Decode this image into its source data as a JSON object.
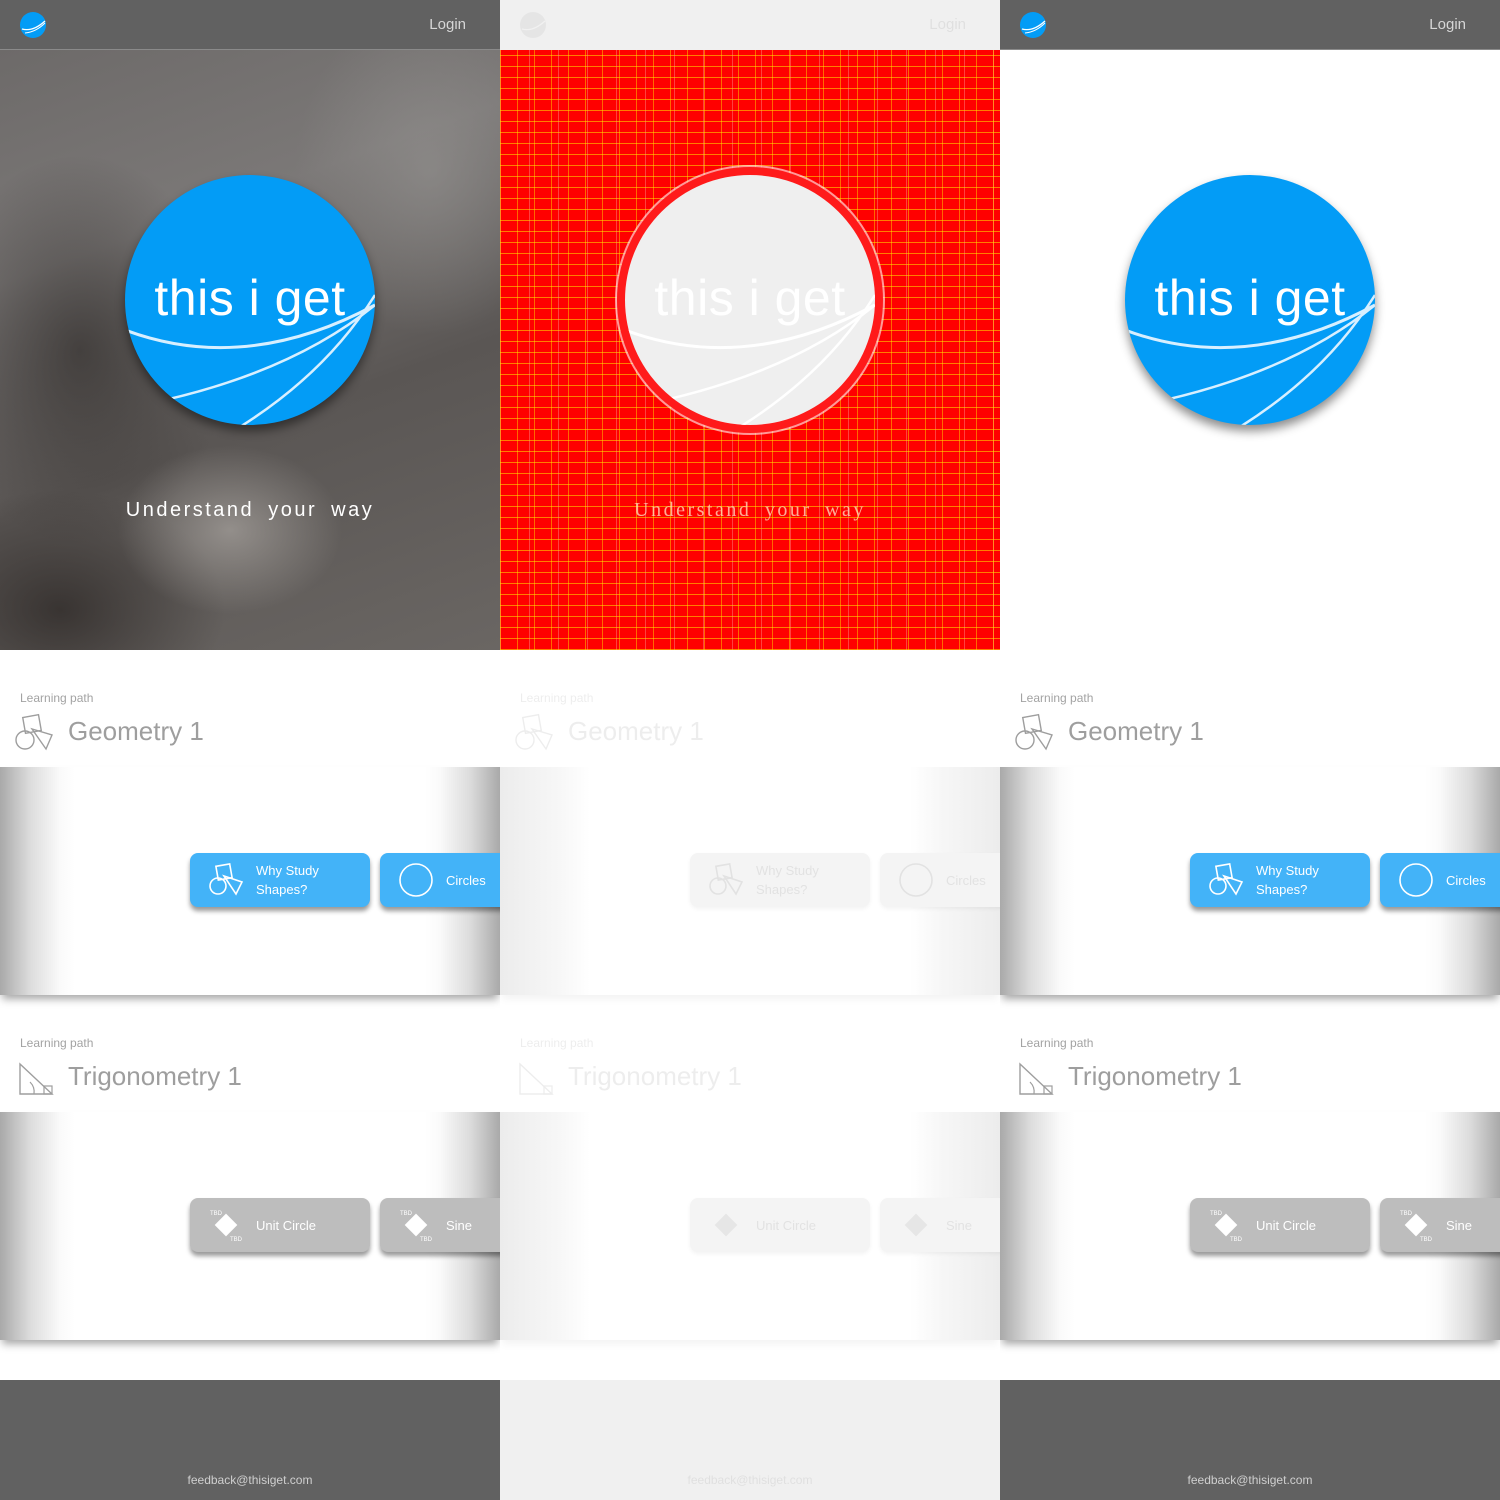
{
  "navbar": {
    "login_label": "Login",
    "logo_icon": "this-i-get-logo"
  },
  "hero": {
    "brand_text": "this i get",
    "tagline": "Understand your way",
    "brand_color": "#039cf6"
  },
  "paths": [
    {
      "section_label": "Learning path",
      "title": "Geometry 1",
      "icon": "shapes-icon",
      "lessons": [
        {
          "label": "Why Study Shapes?",
          "icon": "shapes-icon",
          "status": "available"
        },
        {
          "label": "Circles",
          "icon": "circle-icon",
          "status": "available"
        }
      ]
    },
    {
      "section_label": "Learning path",
      "title": "Trigonometry 1",
      "icon": "triangle-icon",
      "lessons": [
        {
          "label": "Unit Circle",
          "icon": "tbd-icon",
          "status": "locked"
        },
        {
          "label": "Sine",
          "icon": "tbd-icon",
          "status": "locked"
        }
      ]
    }
  ],
  "footer": {
    "email": "feedback@thisiget.com"
  },
  "colors": {
    "lesson_blue": "#43b3f8",
    "lesson_gray": "#bdbdbd",
    "navbar": "#616161",
    "red_variant": "#ff0000"
  }
}
